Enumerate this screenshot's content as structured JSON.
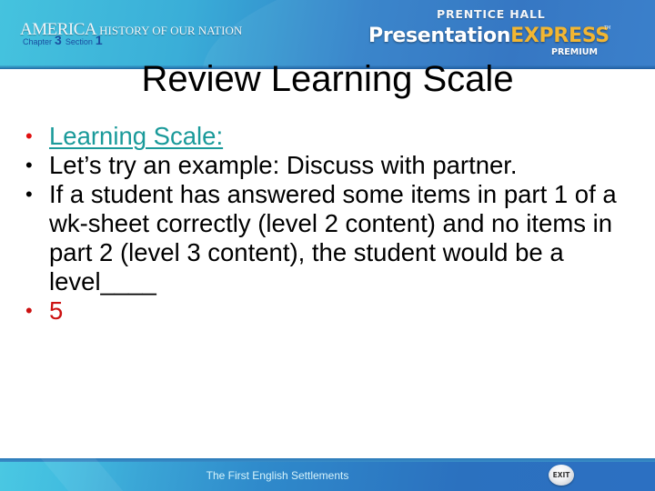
{
  "header": {
    "series_title_big": "AMERICA",
    "series_title_small": "HISTORY OF OUR NATION",
    "chapter_label": "Chapter",
    "chapter_number": "3",
    "section_label": "Section",
    "section_number": "1",
    "publisher": "PRENTICE HALL",
    "product_name_part1": "Presentation",
    "product_name_part2": "EXPRESS",
    "trademark": "TM",
    "edition": "PREMIUM"
  },
  "slide": {
    "title": "Review Learning Scale",
    "bullets": [
      {
        "text": "Learning Scale:",
        "style": "link"
      },
      {
        "text": "Let’s try an example: Discuss with partner.",
        "style": "normal"
      },
      {
        "text": "If a student has answered some items in part 1 of a wk-sheet correctly (level 2 content) and no items in part 2 (level 3 content), the student would be a level____",
        "style": "normal"
      },
      {
        "text": "5",
        "style": "answer"
      }
    ],
    "bullet_glyph": "•"
  },
  "footer": {
    "lesson_title": "The First English Settlements",
    "exit_label": "EXIT"
  },
  "colors": {
    "header_light": "#45c3de",
    "header_dark": "#2a6fc0",
    "link_teal": "#1a9a9a",
    "answer_red": "#cc1111",
    "express_gold": "#f2b632"
  }
}
